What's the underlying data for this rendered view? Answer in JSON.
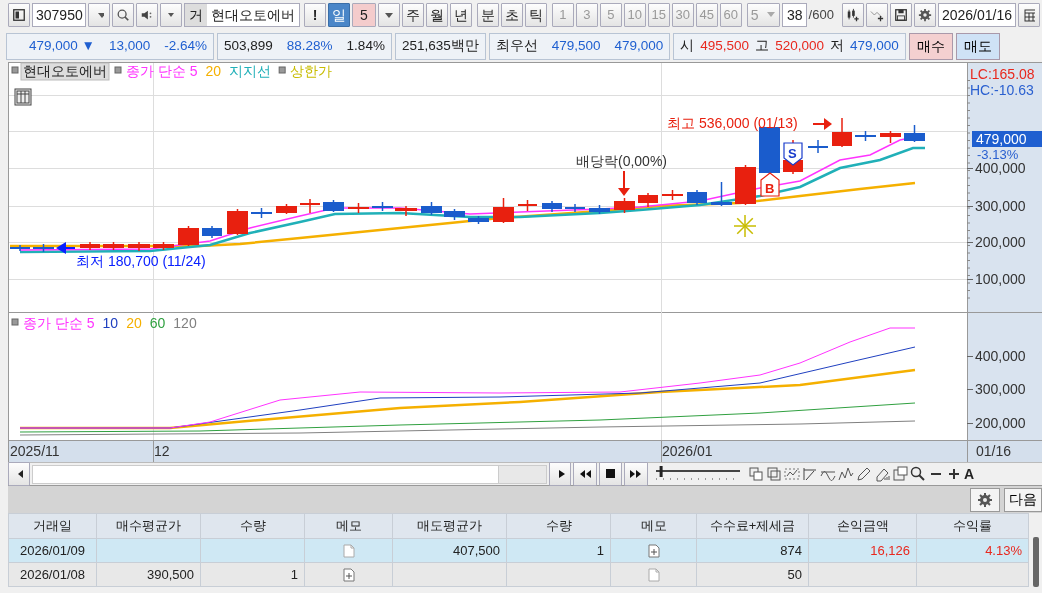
{
  "toolbar": {
    "code": "307950",
    "kind_label": "거",
    "stock_name": "현대오토에버",
    "alert_button": "!",
    "periods": [
      {
        "kind": "period",
        "label": "일",
        "selected": true
      },
      {
        "kind": "count",
        "label": "5"
      },
      {
        "kind": "period",
        "label": "주",
        "selected": false
      },
      {
        "kind": "period",
        "label": "월",
        "selected": false
      },
      {
        "kind": "period",
        "label": "년",
        "selected": false
      },
      {
        "kind": "gap"
      },
      {
        "kind": "period",
        "label": "분",
        "selected": false
      },
      {
        "kind": "period",
        "label": "초",
        "selected": false
      },
      {
        "kind": "period",
        "label": "틱",
        "selected": false
      }
    ],
    "minute_steps": [
      {
        "label": "1",
        "disabled": true
      },
      {
        "label": "3",
        "disabled": true
      },
      {
        "label": "5",
        "disabled": true
      },
      {
        "label": "10",
        "disabled": true
      },
      {
        "label": "15",
        "disabled": true
      },
      {
        "label": "30",
        "disabled": true
      },
      {
        "label": "45",
        "disabled": true
      },
      {
        "label": "60",
        "disabled": true
      }
    ],
    "minute_count": {
      "value": "5",
      "disabled": true
    },
    "bar_count": "38",
    "bar_total": "/600",
    "date": "2026/01/16"
  },
  "quote": {
    "groups": [
      [
        {
          "text": "479,000 ▼",
          "color": "#1f5fd0"
        },
        {
          "text": "13,000",
          "color": "#1f5fd0"
        },
        {
          "text": "-2.64%",
          "color": "#1f5fd0"
        }
      ],
      [
        {
          "text": "503,899",
          "color": "#222222"
        },
        {
          "text": "88.28%",
          "color": "#1f5fd0"
        },
        {
          "text": "1.84%",
          "color": "#222222"
        }
      ],
      [
        {
          "text": "251,635백만",
          "color": "#222222"
        }
      ],
      [
        {
          "text": "최우선"
        },
        {
          "text": "479,500",
          "color": "#1f5fd0"
        },
        {
          "text": "479,000",
          "color": "#1f5fd0"
        }
      ],
      [
        {
          "text": "시"
        },
        {
          "text": "495,500",
          "color": "#e8281e"
        },
        {
          "text": "고"
        },
        {
          "text": "520,000",
          "color": "#e8281e"
        },
        {
          "text": "저"
        },
        {
          "text": "479,000",
          "color": "#1f5fd0"
        }
      ]
    ],
    "buttons": [
      {
        "label": "매수",
        "kind": "buy"
      },
      {
        "label": "매도",
        "kind": "sell"
      }
    ]
  },
  "chart": {
    "legend": [
      {
        "label": "현대오토에버",
        "kind": "name",
        "marker": true
      },
      {
        "label": "종가 단순 5",
        "kind": "series",
        "color": "#ff33ff",
        "marker": true
      },
      {
        "label": "20",
        "kind": "series",
        "color": "#f5b000",
        "marker": false
      },
      {
        "label": "지지선",
        "kind": "series",
        "color": "#20b0b8",
        "marker": false
      },
      {
        "label": "상한가",
        "kind": "series",
        "color": "#c8bc00",
        "marker": true
      }
    ],
    "annotations": [
      {
        "kind": "low",
        "text": "최저 180,700 (11/24)"
      },
      {
        "kind": "dividend",
        "text": "배당락(0,00%)"
      },
      {
        "kind": "high",
        "text": "최고 536,000 (01/13)"
      }
    ],
    "signals": [
      {
        "kind": "buy",
        "text": "B"
      },
      {
        "kind": "sell",
        "text": "S"
      }
    ],
    "axis": {
      "lc": "LC:165.08",
      "hc": "HC:-10.63",
      "ticks": [
        "400,000",
        "300,000",
        "200,000",
        "100,000"
      ],
      "price_tag": "479,000",
      "change_tag": "-3.13%"
    },
    "sub_legend": [
      {
        "label": "종가 단순 5",
        "color": "#ff33ff",
        "marker": true
      },
      {
        "label": "10",
        "color": "#2040c0",
        "marker": false
      },
      {
        "label": "20",
        "color": "#f5b000",
        "marker": false
      },
      {
        "label": "60",
        "color": "#30a040",
        "marker": false
      },
      {
        "label": "120",
        "color": "#808080",
        "marker": false
      }
    ],
    "sub_ticks": [
      "400,000",
      "300,000",
      "200,000"
    ],
    "dates": [
      "2025/11",
      "12",
      "2026/01",
      "01/16"
    ]
  },
  "chart_tools": {
    "zoom_slider": {
      "level": 0.05
    },
    "tail_text": "A"
  },
  "panel": {
    "next_button": "다음"
  },
  "table": {
    "columns": [
      "거래일",
      "매수평균가",
      "수량",
      "메모",
      "매도평균가",
      "수량",
      "메모",
      "수수료+제세금",
      "손익금액",
      "수익률"
    ],
    "rows": [
      {
        "selected": true,
        "color": "#e8281e",
        "date": "2026/01/09",
        "buy_memo": {
          "kind": "plain"
        },
        "sell_price": "407,500",
        "sell_qty": "1",
        "sell_memo": {
          "kind": "add"
        },
        "fee": "874",
        "profit": "16,126",
        "return": "4.13%"
      },
      {
        "selected": false,
        "date": "2026/01/08",
        "buy_price": "390,500",
        "buy_qty": "1",
        "buy_memo": {
          "kind": "add"
        },
        "sell_memo": {
          "kind": "plain"
        },
        "fee": "50"
      }
    ]
  }
}
